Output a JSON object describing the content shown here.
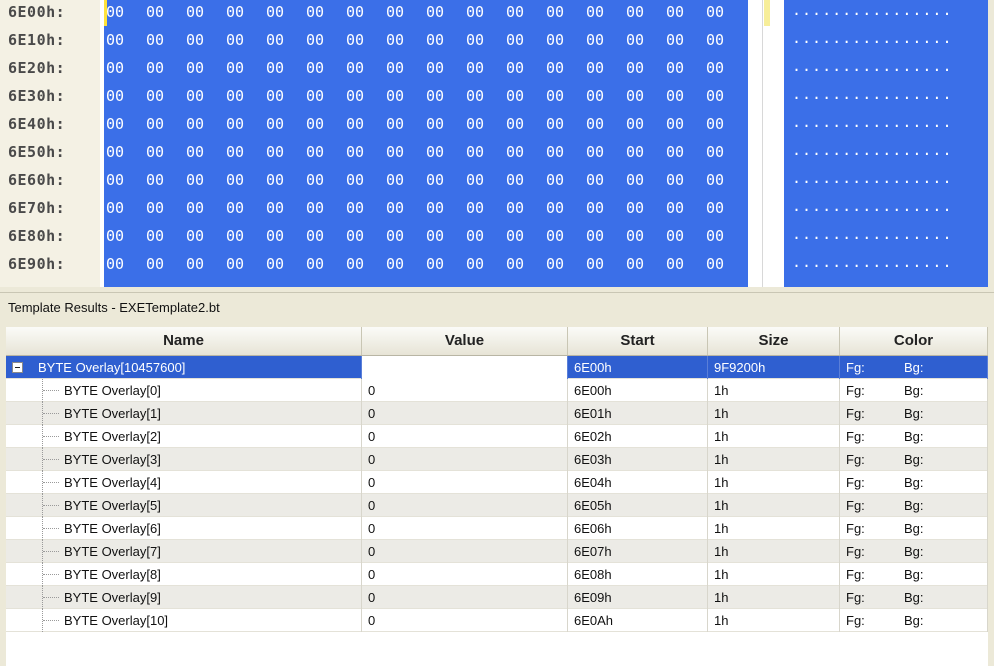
{
  "hex_view": {
    "rows": [
      {
        "addr": "6E00h:",
        "bytes": [
          "00",
          "00",
          "00",
          "00",
          "00",
          "00",
          "00",
          "00",
          "00",
          "00",
          "00",
          "00",
          "00",
          "00",
          "00",
          "00"
        ],
        "ascii": "................"
      },
      {
        "addr": "6E10h:",
        "bytes": [
          "00",
          "00",
          "00",
          "00",
          "00",
          "00",
          "00",
          "00",
          "00",
          "00",
          "00",
          "00",
          "00",
          "00",
          "00",
          "00"
        ],
        "ascii": "................"
      },
      {
        "addr": "6E20h:",
        "bytes": [
          "00",
          "00",
          "00",
          "00",
          "00",
          "00",
          "00",
          "00",
          "00",
          "00",
          "00",
          "00",
          "00",
          "00",
          "00",
          "00"
        ],
        "ascii": "................"
      },
      {
        "addr": "6E30h:",
        "bytes": [
          "00",
          "00",
          "00",
          "00",
          "00",
          "00",
          "00",
          "00",
          "00",
          "00",
          "00",
          "00",
          "00",
          "00",
          "00",
          "00"
        ],
        "ascii": "................"
      },
      {
        "addr": "6E40h:",
        "bytes": [
          "00",
          "00",
          "00",
          "00",
          "00",
          "00",
          "00",
          "00",
          "00",
          "00",
          "00",
          "00",
          "00",
          "00",
          "00",
          "00"
        ],
        "ascii": "................"
      },
      {
        "addr": "6E50h:",
        "bytes": [
          "00",
          "00",
          "00",
          "00",
          "00",
          "00",
          "00",
          "00",
          "00",
          "00",
          "00",
          "00",
          "00",
          "00",
          "00",
          "00"
        ],
        "ascii": "................"
      },
      {
        "addr": "6E60h:",
        "bytes": [
          "00",
          "00",
          "00",
          "00",
          "00",
          "00",
          "00",
          "00",
          "00",
          "00",
          "00",
          "00",
          "00",
          "00",
          "00",
          "00"
        ],
        "ascii": "................"
      },
      {
        "addr": "6E70h:",
        "bytes": [
          "00",
          "00",
          "00",
          "00",
          "00",
          "00",
          "00",
          "00",
          "00",
          "00",
          "00",
          "00",
          "00",
          "00",
          "00",
          "00"
        ],
        "ascii": "................"
      },
      {
        "addr": "6E80h:",
        "bytes": [
          "00",
          "00",
          "00",
          "00",
          "00",
          "00",
          "00",
          "00",
          "00",
          "00",
          "00",
          "00",
          "00",
          "00",
          "00",
          "00"
        ],
        "ascii": "................"
      },
      {
        "addr": "6E90h:",
        "bytes": [
          "00",
          "00",
          "00",
          "00",
          "00",
          "00",
          "00",
          "00",
          "00",
          "00",
          "00",
          "00",
          "00",
          "00",
          "00",
          "00"
        ],
        "ascii": "................"
      }
    ],
    "selection_color": "#3b6fe8",
    "caret_color": "#ffe23a"
  },
  "template_results": {
    "title": "Template Results - EXETemplate2.bt",
    "columns": {
      "name": "Name",
      "value": "Value",
      "start": "Start",
      "size": "Size",
      "color": "Color"
    },
    "rows": [
      {
        "name": "BYTE Overlay[10457600]",
        "value": "",
        "start": "6E00h",
        "size": "9F9200h",
        "fg": "Fg:",
        "bg": "Bg:",
        "selected": true,
        "expandable": true
      },
      {
        "name": "BYTE Overlay[0]",
        "value": "0",
        "start": "6E00h",
        "size": "1h",
        "fg": "Fg:",
        "bg": "Bg:"
      },
      {
        "name": "BYTE Overlay[1]",
        "value": "0",
        "start": "6E01h",
        "size": "1h",
        "fg": "Fg:",
        "bg": "Bg:"
      },
      {
        "name": "BYTE Overlay[2]",
        "value": "0",
        "start": "6E02h",
        "size": "1h",
        "fg": "Fg:",
        "bg": "Bg:"
      },
      {
        "name": "BYTE Overlay[3]",
        "value": "0",
        "start": "6E03h",
        "size": "1h",
        "fg": "Fg:",
        "bg": "Bg:"
      },
      {
        "name": "BYTE Overlay[4]",
        "value": "0",
        "start": "6E04h",
        "size": "1h",
        "fg": "Fg:",
        "bg": "Bg:"
      },
      {
        "name": "BYTE Overlay[5]",
        "value": "0",
        "start": "6E05h",
        "size": "1h",
        "fg": "Fg:",
        "bg": "Bg:"
      },
      {
        "name": "BYTE Overlay[6]",
        "value": "0",
        "start": "6E06h",
        "size": "1h",
        "fg": "Fg:",
        "bg": "Bg:"
      },
      {
        "name": "BYTE Overlay[7]",
        "value": "0",
        "start": "6E07h",
        "size": "1h",
        "fg": "Fg:",
        "bg": "Bg:"
      },
      {
        "name": "BYTE Overlay[8]",
        "value": "0",
        "start": "6E08h",
        "size": "1h",
        "fg": "Fg:",
        "bg": "Bg:"
      },
      {
        "name": "BYTE Overlay[9]",
        "value": "0",
        "start": "6E09h",
        "size": "1h",
        "fg": "Fg:",
        "bg": "Bg:"
      },
      {
        "name": "BYTE Overlay[10]",
        "value": "0",
        "start": "6E0Ah",
        "size": "1h",
        "fg": "Fg:",
        "bg": "Bg:"
      }
    ],
    "selected_row_color": "#2f5fd0"
  }
}
